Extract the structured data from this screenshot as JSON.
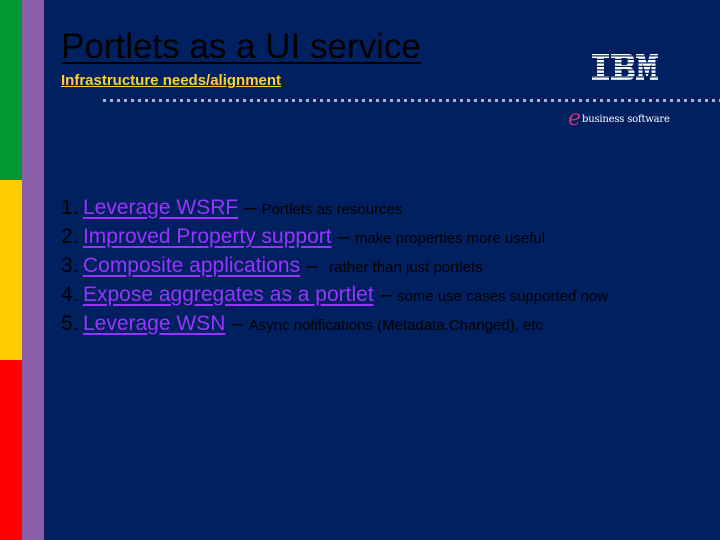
{
  "slide": {
    "title": "Portlets as a UI service",
    "subtitle": "Infrastructure needs/alignment",
    "logo": {
      "brand": "IBM",
      "tagline_letter": "e",
      "tagline": "business software"
    },
    "colors": {
      "background": "#002060",
      "stripe_green": "#009933",
      "stripe_yellow": "#ffcc00",
      "stripe_red": "#ff0000",
      "stripe_purple": "#8a5ea8",
      "link": "#9933ff",
      "subtitle": "#ffcc33"
    },
    "items": [
      {
        "number": "1.",
        "link": "Leverage WSRF",
        "separator": " – ",
        "description": "Portlets as resources"
      },
      {
        "number": "2.",
        "link": "Improved Property support",
        "separator": " – ",
        "description": "make properties more useful"
      },
      {
        "number": "3.",
        "link": "Composite applications",
        "separator": " –  ",
        "description": "rather than just portlets"
      },
      {
        "number": "4.",
        "link": "Expose aggregates as a portlet",
        "separator": " – ",
        "description": "some use cases supported now"
      },
      {
        "number": "5.",
        "link": "Leverage WSN",
        "separator": " – ",
        "description": "Async notifications (Metadata.Changed), etc"
      }
    ]
  }
}
